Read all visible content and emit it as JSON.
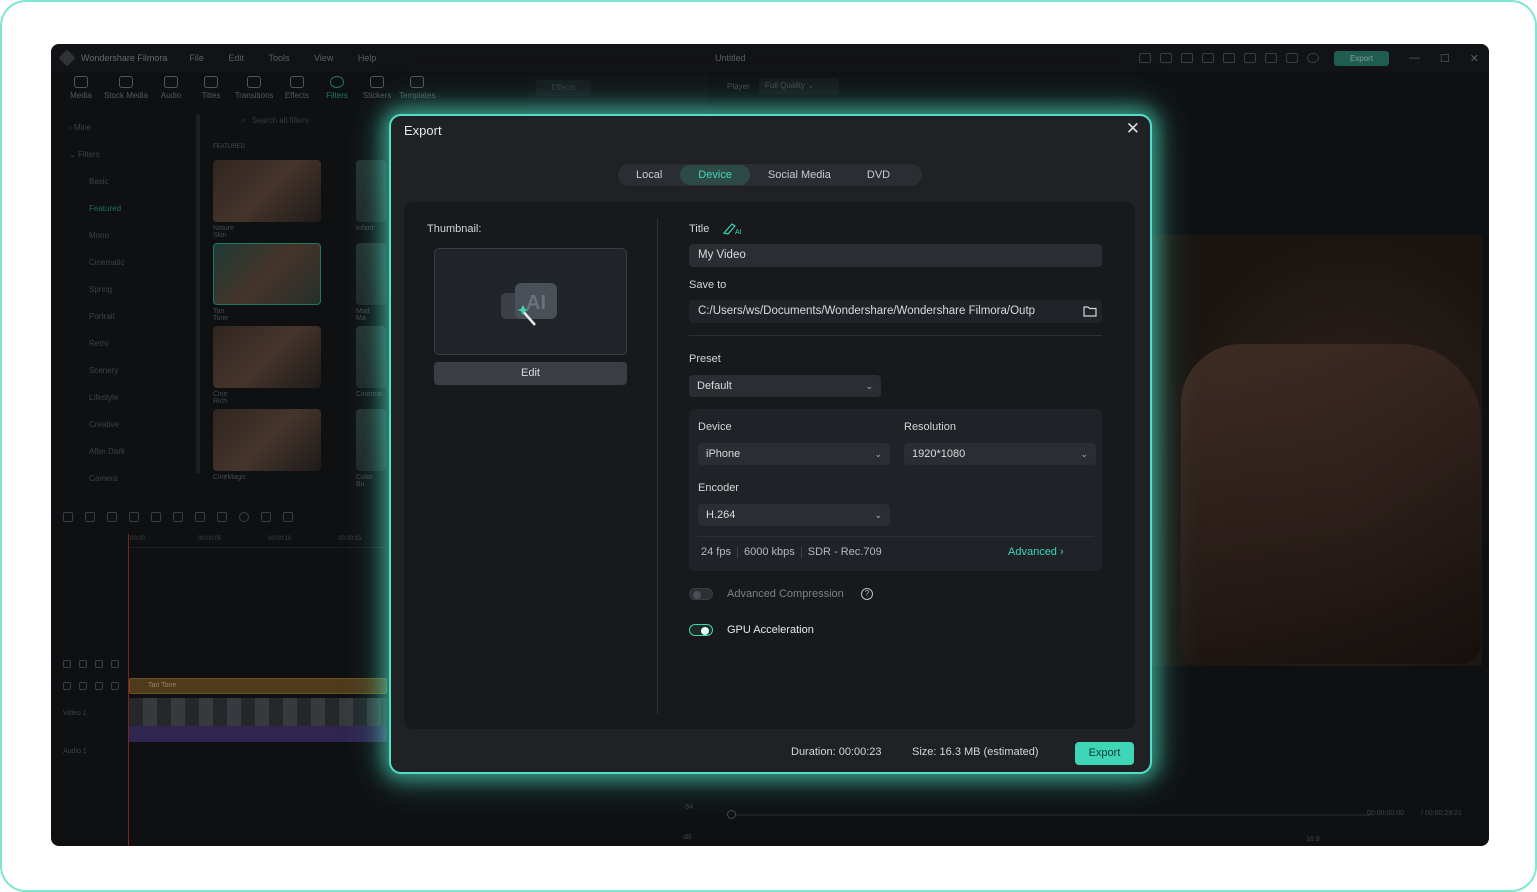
{
  "app": {
    "name": "Wondershare Filmora",
    "menu": [
      "File",
      "Edit",
      "Tools",
      "View",
      "Help"
    ],
    "document_title": "Untitled",
    "export_label": "Export",
    "window_controls": [
      "—",
      "☐",
      "✕"
    ]
  },
  "toolbar": {
    "items": [
      {
        "label": "Media",
        "icon": "media-icon"
      },
      {
        "label": "Stock Media",
        "icon": "stock-media-icon"
      },
      {
        "label": "Audio",
        "icon": "audio-icon"
      },
      {
        "label": "Titles",
        "icon": "titles-icon"
      },
      {
        "label": "Transitions",
        "icon": "transitions-icon"
      },
      {
        "label": "Effects",
        "icon": "effects-icon"
      },
      {
        "label": "Filters",
        "icon": "filters-icon"
      },
      {
        "label": "Stickers",
        "icon": "stickers-icon"
      },
      {
        "label": "Templates",
        "icon": "templates-icon"
      }
    ]
  },
  "leftnav": {
    "mine": "Mine",
    "filters": "Filters",
    "categories": [
      "Basic",
      "Featured",
      "Mono",
      "Cinematic",
      "Spring",
      "Portrait",
      "Retro",
      "Scenery",
      "Lifestyle",
      "Creative",
      "After Dark",
      "Camera"
    ]
  },
  "filters_panel": {
    "search_placeholder": "Search all filters",
    "section": "FEATURED",
    "thumbs": [
      "Nature Skin",
      "Tan Tone",
      "Cine Rich",
      "CineMagic"
    ],
    "thumbs_col2": [
      "Infant",
      "Mad Ma",
      "Cinemat",
      "Color Bu"
    ]
  },
  "effects_tab": "Effects",
  "player": {
    "label": "Player",
    "quality": "Full Quality",
    "time_current": "00:00:00:00",
    "time_total": "/ 00:00:29:21",
    "ratio": "16:9"
  },
  "timeline": {
    "ruler": [
      "00:00",
      "00:00:05",
      "00:00:10",
      "00:00:15"
    ],
    "clip_label": "Tan Tone",
    "video_track": "Video 1",
    "audio_track": "Audio 1",
    "meter": [
      "-54",
      "dB"
    ]
  },
  "export_dialog": {
    "title": "Export",
    "tabs": [
      "Local",
      "Device",
      "Social Media",
      "DVD"
    ],
    "active_tab": "Device",
    "thumbnail_label": "Thumbnail:",
    "edit_label": "Edit",
    "title_label": "Title",
    "title_value": "My Video",
    "save_to_label": "Save to",
    "save_to_value": "C:/Users/ws/Documents/Wondershare/Wondershare Filmora/Outp",
    "preset_label": "Preset",
    "preset_value": "Default",
    "device_label": "Device",
    "device_value": "iPhone",
    "resolution_label": "Resolution",
    "resolution_value": "1920*1080",
    "encoder_label": "Encoder",
    "encoder_value": "H.264",
    "fps": "24 fps",
    "bitrate": "6000 kbps",
    "color": "SDR - Rec.709",
    "advanced_label": "Advanced",
    "advanced_compression_label": "Advanced Compression",
    "advanced_compression_on": false,
    "gpu_label": "GPU Acceleration",
    "gpu_on": true,
    "duration_label": "Duration:",
    "duration_value": "00:00:23",
    "size_label": "Size:",
    "size_value": "16.3 MB (estimated)",
    "export_label": "Export"
  },
  "colors": {
    "accent": "#3fd6b8",
    "glow": "#4fe0c6",
    "dialog_bg": "#1f2125"
  }
}
